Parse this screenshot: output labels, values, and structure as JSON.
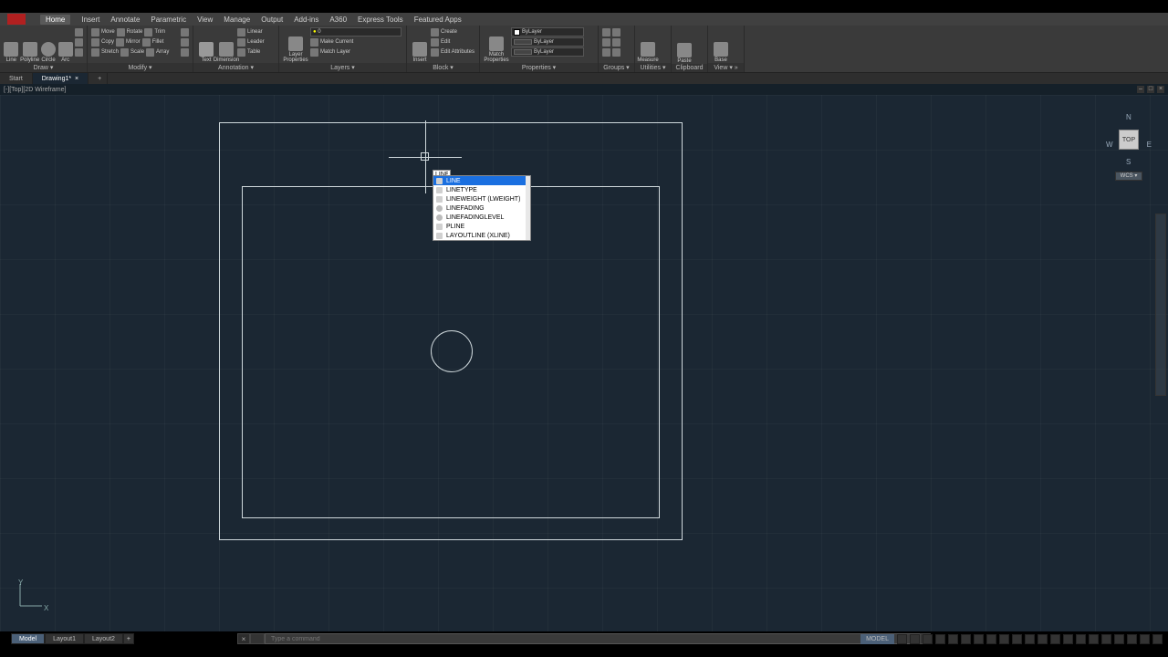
{
  "menu": {
    "tabs": [
      "Home",
      "Insert",
      "Annotate",
      "Parametric",
      "View",
      "Manage",
      "Output",
      "Add-ins",
      "A360",
      "Express Tools",
      "Featured Apps"
    ],
    "active": 0
  },
  "ribbon": {
    "draw": {
      "title": "Draw ▾",
      "tools": [
        "Line",
        "Polyline",
        "Circle",
        "Arc"
      ]
    },
    "modify": {
      "title": "Modify ▾",
      "rows": [
        [
          "Move",
          "Rotate",
          "Trim"
        ],
        [
          "Copy",
          "Mirror",
          "Fillet"
        ],
        [
          "Stretch",
          "Scale",
          "Array"
        ]
      ]
    },
    "annotation": {
      "title": "Annotation ▾",
      "big": [
        "Text",
        "Dimension"
      ],
      "rows": [
        "Linear",
        "Leader",
        "Table"
      ]
    },
    "layers": {
      "title": "Layers ▾",
      "big": "Layer Properties",
      "rows": [
        "",
        "Make Current",
        "Match Layer"
      ]
    },
    "block": {
      "title": "Block ▾",
      "big": "Insert",
      "rows": [
        "Create",
        "Edit",
        "Edit Attributes"
      ]
    },
    "properties": {
      "title": "Properties ▾",
      "big": "Match Properties",
      "rows": [
        "ByLayer",
        "ByLayer",
        "ByLayer"
      ]
    },
    "groups": {
      "title": "Groups ▾",
      "big": "Group"
    },
    "utilities": {
      "title": "Utilities ▾",
      "big": "Measure"
    },
    "clipboard": {
      "title": "Clipboard",
      "big": "Paste"
    },
    "view": {
      "title": "View ▾ »",
      "big": "Base"
    }
  },
  "file_tabs": {
    "items": [
      "Start",
      "Drawing1*"
    ],
    "active": 1
  },
  "viewport": {
    "label": "[-][Top][2D Wireframe]",
    "cube": {
      "n": "N",
      "s": "S",
      "e": "E",
      "w": "W",
      "face": "TOP",
      "wcs": "WCS ▾"
    }
  },
  "ucs": {
    "x": "X",
    "y": "Y"
  },
  "dynamic_input": {
    "value": "LINE"
  },
  "autocomplete": {
    "items": [
      "LINE",
      "LINETYPE",
      "LINEWEIGHT (LWEIGHT)",
      "LINEFADING",
      "LINEFADINGLEVEL",
      "PLINE",
      "LAYOUTLINE (XLINE)"
    ],
    "selected": 0
  },
  "cmd": {
    "placeholder": "Type a command"
  },
  "layout_tabs": {
    "items": [
      "Model",
      "Layout1",
      "Layout2"
    ],
    "active": 0
  },
  "status": {
    "model": "MODEL"
  }
}
